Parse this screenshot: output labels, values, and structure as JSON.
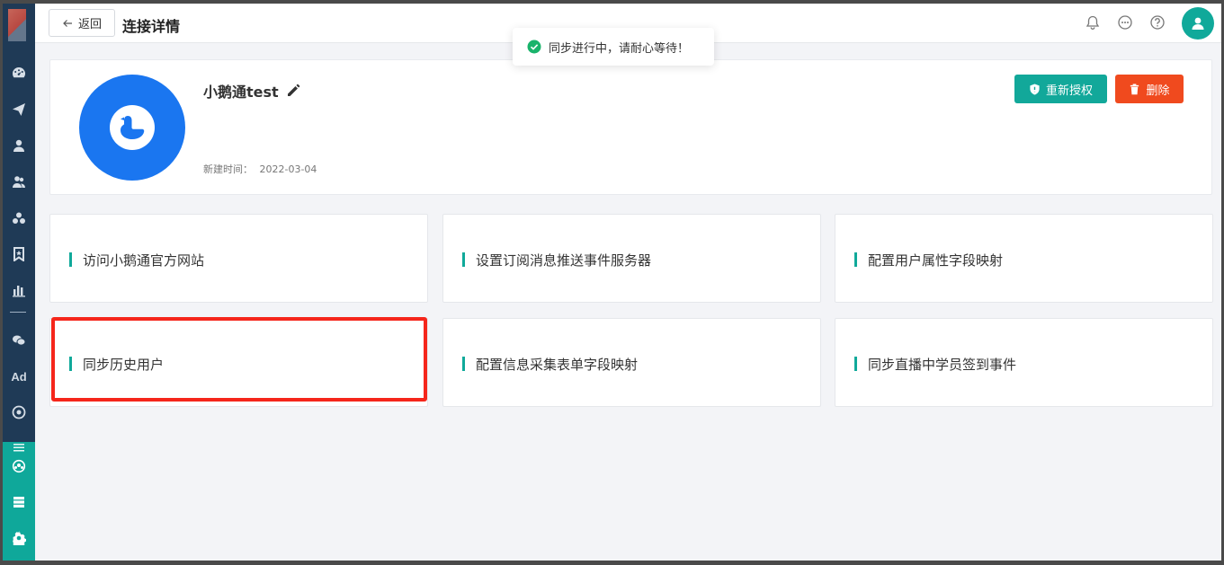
{
  "header": {
    "back_label": "返回",
    "title": "连接详情"
  },
  "toast": {
    "message": "同步进行中，请耐心等待！",
    "icon": "check-circle-icon",
    "color": "#19b36b"
  },
  "connection": {
    "name": "小鹅通test",
    "created_label": "新建时间：",
    "created_date": "2022-03-04",
    "logo_color": "#1a76f0"
  },
  "actions": {
    "reauthorize_label": "重新授权",
    "delete_label": "删除"
  },
  "cards": [
    {
      "label": "访问小鹅通官方网站"
    },
    {
      "label": "设置订阅消息推送事件服务器"
    },
    {
      "label": "配置用户属性字段映射"
    },
    {
      "label": "同步历史用户"
    },
    {
      "label": "配置信息采集表单字段映射"
    },
    {
      "label": "同步直播中学员签到事件"
    }
  ],
  "sidebar": {
    "items": [
      "dashboard-icon",
      "send-icon",
      "user-icon",
      "users-icon",
      "cluster-icon",
      "bookmark-icon",
      "bar-chart-icon",
      "wechat-icon",
      "Ad",
      "target-icon",
      "list-icon",
      "group-icon",
      "server-icon",
      "gear-icon"
    ]
  },
  "colors": {
    "sidebar": "#1f3a56",
    "accent": "#10a99a",
    "danger": "#f04a1e",
    "highlight": "#f5261b"
  }
}
